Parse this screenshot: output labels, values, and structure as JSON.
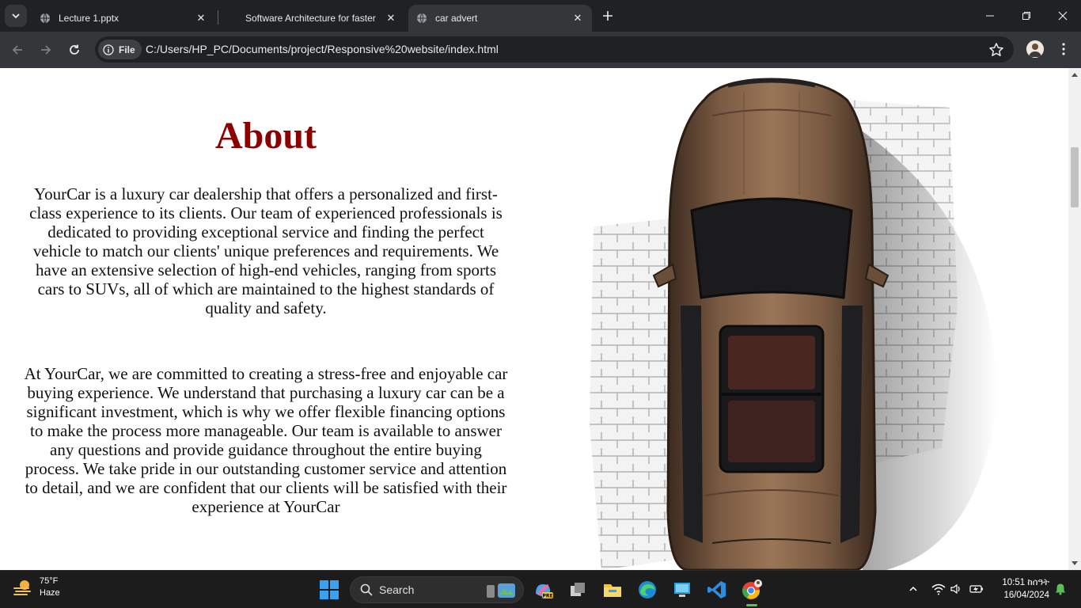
{
  "browser": {
    "tabs": [
      {
        "title": "Lecture 1.pptx",
        "active": false
      },
      {
        "title": "Software Architecture for faster",
        "active": false
      },
      {
        "title": "car advert",
        "active": true
      }
    ],
    "site_chip": "File",
    "url": "C:/Users/HP_PC/Documents/project/Responsive%20website/index.html"
  },
  "page": {
    "about_title": "About",
    "paragraphs": [
      "YourCar is a luxury car dealership that offers a personalized and first-class experience to its clients. Our team of experienced professionals is dedicated to providing exceptional service and finding the perfect vehicle to match our clients' unique preferences and requirements. We have an extensive selection of high-end vehicles, ranging from sports cars to SUVs, all of which are maintained to the highest standards of quality and safety.",
      "At YourCar, we are committed to creating a stress-free and enjoyable car buying experience. We understand that purchasing a luxury car can be a significant investment, which is why we offer flexible financing options to make the process more manageable. Our team is available to answer any questions and provide guidance throughout the entire buying process. We take pride in our outstanding customer service and attention to detail, and we are confident that our clients will be satisfied with their experience at YourCar"
    ],
    "accent_color": "#8b0000"
  },
  "taskbar": {
    "weather_temp": "75°F",
    "weather_desc": "Haze",
    "search_label": "Search",
    "time": "10:51 ከሰዓት",
    "date": "16/04/2024",
    "pinned_icons": [
      "copilot-icon",
      "task-view-icon",
      "file-explorer-icon",
      "edge-icon",
      "desktop-app-icon",
      "vscode-icon",
      "chrome-icon"
    ]
  }
}
